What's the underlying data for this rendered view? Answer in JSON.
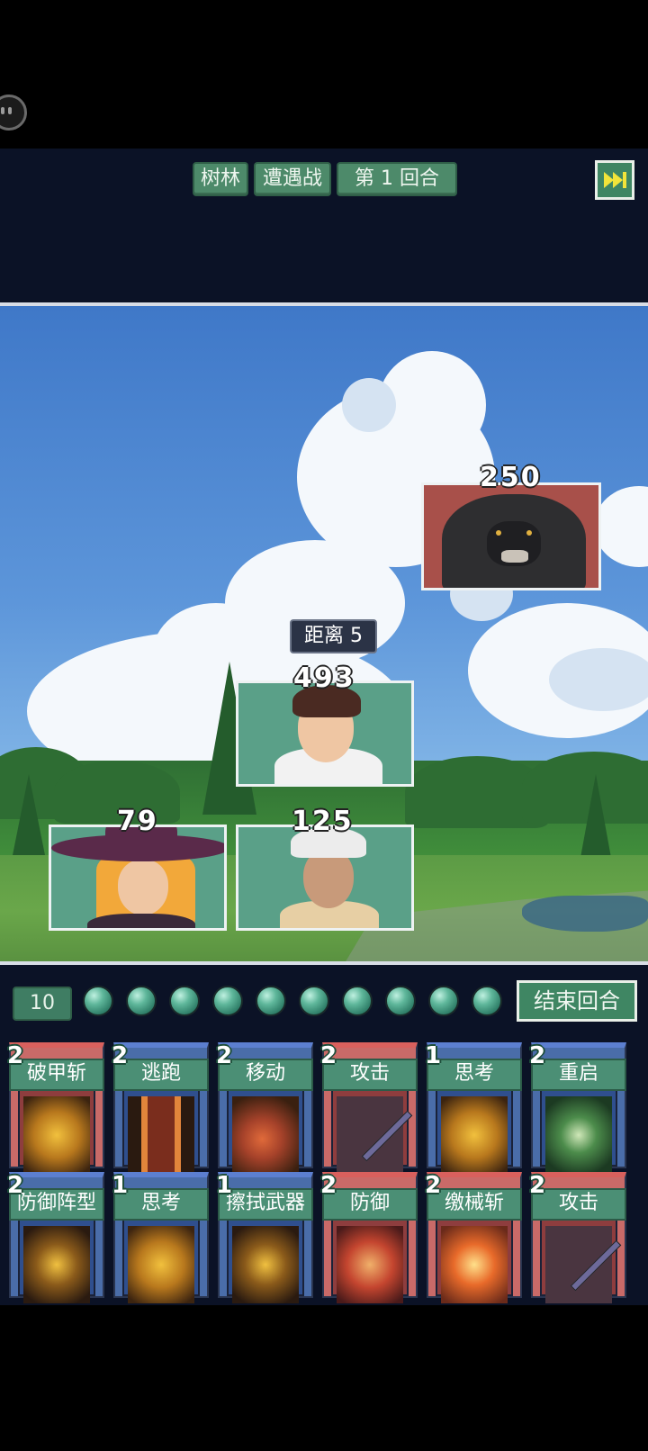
{
  "header": {
    "location": "树林",
    "battle_type": "遭遇战",
    "round_label": "第 1 回合"
  },
  "battle": {
    "distance_label": "距离 5",
    "enemy": {
      "name": "bear",
      "hp": "250"
    },
    "party": [
      {
        "name": "young-man",
        "hp": "493"
      },
      {
        "name": "witch",
        "hp": "79"
      },
      {
        "name": "boy-bucket-hat",
        "hp": "125"
      }
    ]
  },
  "energy": {
    "count": "10",
    "orbs": 10,
    "end_turn_label": "结束回合"
  },
  "hand": {
    "row1": [
      {
        "cost": "2",
        "name": "破甲斩",
        "color": "red",
        "art": "gold"
      },
      {
        "cost": "2",
        "name": "逃跑",
        "color": "blue",
        "art": "door"
      },
      {
        "cost": "2",
        "name": "移动",
        "color": "blue",
        "art": "fist"
      },
      {
        "cost": "2",
        "name": "攻击",
        "color": "red",
        "art": "blade"
      },
      {
        "cost": "1",
        "name": "思考",
        "color": "blue",
        "art": "gold"
      },
      {
        "cost": "2",
        "name": "重启",
        "color": "blue",
        "art": "green"
      }
    ],
    "row2": [
      {
        "cost": "2",
        "name": "防御阵型",
        "color": "blue",
        "art": "armor"
      },
      {
        "cost": "1",
        "name": "思考",
        "color": "blue",
        "art": "gold"
      },
      {
        "cost": "1",
        "name": "擦拭武器",
        "color": "blue",
        "art": "armor"
      },
      {
        "cost": "2",
        "name": "防御",
        "color": "red",
        "art": "shield"
      },
      {
        "cost": "2",
        "name": "缴械斩",
        "color": "red",
        "art": "burst"
      },
      {
        "cost": "2",
        "name": "攻击",
        "color": "red",
        "art": "blade"
      }
    ]
  },
  "colors": {
    "accent_green": "#3f8663",
    "card_red": "#c96a68",
    "card_blue": "#4a6da9",
    "panel_bg": "#0b1226"
  }
}
